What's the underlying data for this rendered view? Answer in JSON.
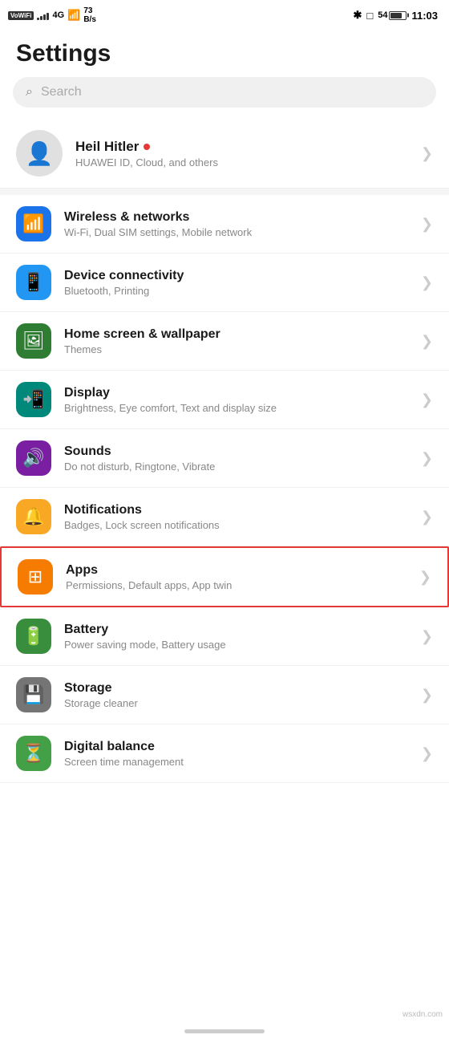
{
  "statusBar": {
    "carrier": "VoWiFi",
    "signal": "4G",
    "wifi": true,
    "speed": "73\nB/s",
    "bluetooth": "✱",
    "battery": "54",
    "time": "11:03"
  },
  "pageTitle": "Settings",
  "search": {
    "placeholder": "Search"
  },
  "profile": {
    "name": "Heil Hitler",
    "dot": true,
    "sub": "HUAWEI ID, Cloud, and others"
  },
  "settingsItems": [
    {
      "id": "wireless",
      "iconColor": "icon-blue",
      "iconSymbol": "📶",
      "title": "Wireless & networks",
      "sub": "Wi-Fi, Dual SIM settings, Mobile network",
      "highlighted": false
    },
    {
      "id": "device",
      "iconColor": "icon-blue2",
      "iconSymbol": "📱",
      "title": "Device connectivity",
      "sub": "Bluetooth, Printing",
      "highlighted": false
    },
    {
      "id": "homescreen",
      "iconColor": "icon-green-dark",
      "iconSymbol": "🖼",
      "title": "Home screen & wallpaper",
      "sub": "Themes",
      "highlighted": false
    },
    {
      "id": "display",
      "iconColor": "icon-teal",
      "iconSymbol": "📲",
      "title": "Display",
      "sub": "Brightness, Eye comfort, Text and display size",
      "highlighted": false
    },
    {
      "id": "sounds",
      "iconColor": "icon-purple",
      "iconSymbol": "🔊",
      "title": "Sounds",
      "sub": "Do not disturb, Ringtone, Vibrate",
      "highlighted": false
    },
    {
      "id": "notifications",
      "iconColor": "icon-yellow",
      "iconSymbol": "🔔",
      "title": "Notifications",
      "sub": "Badges, Lock screen notifications",
      "highlighted": false
    },
    {
      "id": "apps",
      "iconColor": "icon-orange",
      "iconSymbol": "⊞",
      "title": "Apps",
      "sub": "Permissions, Default apps, App twin",
      "highlighted": true
    },
    {
      "id": "battery",
      "iconColor": "icon-green2",
      "iconSymbol": "🔋",
      "title": "Battery",
      "sub": "Power saving mode, Battery usage",
      "highlighted": false
    },
    {
      "id": "storage",
      "iconColor": "icon-gray",
      "iconSymbol": "💾",
      "title": "Storage",
      "sub": "Storage cleaner",
      "highlighted": false
    },
    {
      "id": "digitalbalance",
      "iconColor": "icon-green",
      "iconSymbol": "⏳",
      "title": "Digital balance",
      "sub": "Screen time management",
      "highlighted": false
    }
  ]
}
